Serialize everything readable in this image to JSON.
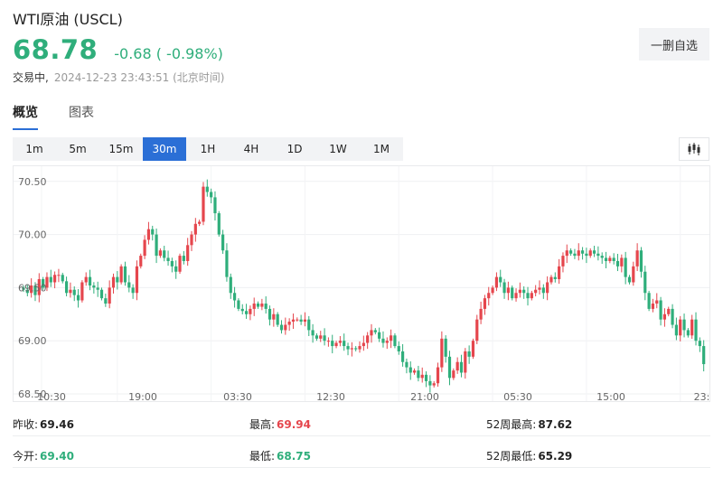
{
  "header": {
    "title": "WTI原油 (USCL)",
    "price": "68.78",
    "change": "-0.68 ( -0.98%)",
    "status": "交易中,",
    "timestamp": "2024-12-23 23:43:51 (北京时间)",
    "watch_button": "一删自选"
  },
  "tabs": [
    {
      "label": "概览",
      "active": true
    },
    {
      "label": "图表",
      "active": false
    }
  ],
  "periods": [
    {
      "label": "1m",
      "active": false
    },
    {
      "label": "5m",
      "active": false
    },
    {
      "label": "15m",
      "active": false
    },
    {
      "label": "30m",
      "active": true
    },
    {
      "label": "1H",
      "active": false
    },
    {
      "label": "4H",
      "active": false
    },
    {
      "label": "1D",
      "active": false
    },
    {
      "label": "1W",
      "active": false
    },
    {
      "label": "1M",
      "active": false
    }
  ],
  "chart_type_icon": "candlestick-icon",
  "colors": {
    "up": "#e5464d",
    "down": "#2fae7b",
    "accent": "#2b6fd6"
  },
  "chart_data": {
    "type": "candlestick",
    "ylim": [
      68.5,
      70.6
    ],
    "yticks": [
      "70.50",
      "70.00",
      "69.50",
      "69.00",
      "68.50"
    ],
    "xticks": [
      "10:30",
      "19:00",
      "03:30",
      "12:30",
      "21:00",
      "05:30",
      "15:00",
      "23:3"
    ],
    "grid": true,
    "close": [
      69.48,
      69.45,
      69.52,
      69.43,
      69.58,
      69.5,
      69.6,
      69.55,
      69.62,
      69.62,
      69.56,
      69.45,
      69.48,
      69.43,
      69.38,
      69.55,
      69.6,
      69.52,
      69.5,
      69.48,
      69.4,
      69.35,
      69.5,
      69.6,
      69.55,
      69.7,
      69.55,
      69.5,
      69.45,
      69.7,
      69.8,
      69.95,
      70.05,
      70.0,
      69.8,
      69.85,
      69.78,
      69.75,
      69.7,
      69.65,
      69.8,
      69.75,
      69.9,
      70.0,
      70.1,
      70.12,
      70.45,
      70.4,
      70.35,
      70.2,
      70.0,
      69.85,
      69.6,
      69.45,
      69.38,
      69.3,
      69.28,
      69.25,
      69.3,
      69.35,
      69.32,
      69.35,
      69.3,
      69.2,
      69.25,
      69.15,
      69.1,
      69.15,
      69.18,
      69.2,
      69.2,
      69.18,
      69.2,
      69.1,
      69.05,
      69.02,
      69.05,
      69.0,
      69.0,
      68.95,
      68.98,
      69.0,
      68.95,
      68.92,
      68.93,
      68.92,
      68.95,
      68.98,
      69.05,
      69.1,
      69.08,
      69.02,
      68.98,
      69.0,
      69.05,
      68.95,
      68.9,
      68.8,
      68.75,
      68.7,
      68.72,
      68.65,
      68.68,
      68.62,
      68.58,
      68.6,
      68.75,
      69.02,
      68.85,
      68.65,
      68.72,
      68.8,
      68.7,
      68.9,
      68.85,
      69.0,
      69.2,
      69.3,
      69.4,
      69.45,
      69.5,
      69.6,
      69.55,
      69.45,
      69.5,
      69.4,
      69.45,
      69.48,
      69.45,
      69.4,
      69.45,
      69.48,
      69.5,
      69.45,
      69.55,
      69.6,
      69.58,
      69.7,
      69.8,
      69.85,
      69.82,
      69.8,
      69.85,
      69.82,
      69.8,
      69.85,
      69.82,
      69.8,
      69.78,
      69.75,
      69.78,
      69.75,
      69.7,
      69.78,
      69.6,
      69.55,
      69.7,
      69.85,
      69.65,
      69.45,
      69.3,
      69.35,
      69.38,
      69.2,
      69.25,
      69.3,
      69.15,
      69.05,
      69.2,
      69.1,
      69.05,
      69.2,
      69.0,
      68.95,
      68.78
    ]
  },
  "stats": {
    "prev_close_label": "昨收:",
    "prev_close": "69.46",
    "high_label": "最高:",
    "high": "69.94",
    "high52_label": "52周最高:",
    "high52": "87.62",
    "open_label": "今开:",
    "open": "69.40",
    "low_label": "最低:",
    "low": "68.75",
    "low52_label": "52周最低:",
    "low52": "65.29"
  }
}
